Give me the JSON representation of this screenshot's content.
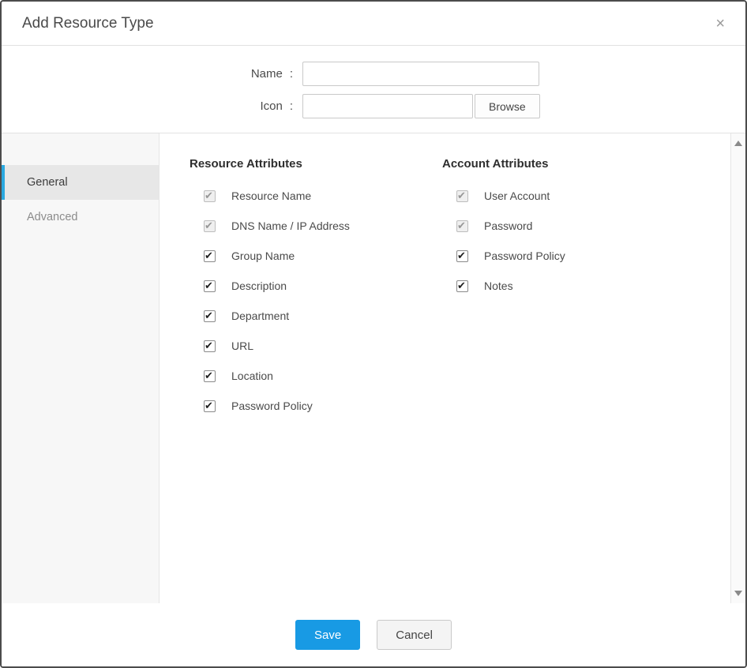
{
  "dialog": {
    "title": "Add Resource Type",
    "close_glyph": "×"
  },
  "form": {
    "name": {
      "label": "Name",
      "colon": ":",
      "value": ""
    },
    "icon": {
      "label": "Icon",
      "colon": ":",
      "value": "",
      "browse_label": "Browse"
    }
  },
  "sidebar": {
    "items": [
      {
        "label": "General",
        "active": true
      },
      {
        "label": "Advanced",
        "active": false
      }
    ]
  },
  "panels": {
    "resource": {
      "heading": "Resource Attributes",
      "items": [
        {
          "label": "Resource Name",
          "checked": true,
          "disabled": true
        },
        {
          "label": "DNS Name / IP Address",
          "checked": true,
          "disabled": true
        },
        {
          "label": "Group Name",
          "checked": true,
          "disabled": false
        },
        {
          "label": "Description",
          "checked": true,
          "disabled": false
        },
        {
          "label": "Department",
          "checked": true,
          "disabled": false
        },
        {
          "label": "URL",
          "checked": true,
          "disabled": false
        },
        {
          "label": "Location",
          "checked": true,
          "disabled": false
        },
        {
          "label": "Password Policy",
          "checked": true,
          "disabled": false
        }
      ]
    },
    "account": {
      "heading": "Account Attributes",
      "items": [
        {
          "label": "User Account",
          "checked": true,
          "disabled": true
        },
        {
          "label": "Password",
          "checked": true,
          "disabled": true
        },
        {
          "label": "Password Policy",
          "checked": true,
          "disabled": false
        },
        {
          "label": "Notes",
          "checked": true,
          "disabled": false
        }
      ]
    }
  },
  "footer": {
    "save_label": "Save",
    "cancel_label": "Cancel"
  },
  "colors": {
    "accent_blue": "#189ae4",
    "active_tab_bar": "#2aa9e0"
  }
}
